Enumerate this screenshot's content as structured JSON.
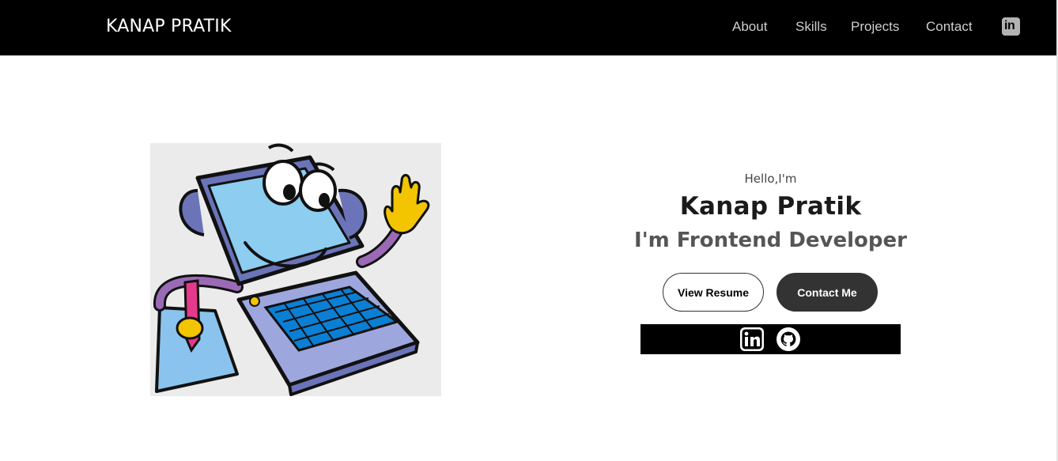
{
  "header": {
    "brand": "KANAP PRATIK",
    "nav": [
      {
        "label": "About"
      },
      {
        "label": "Skills"
      },
      {
        "label": "Projects"
      },
      {
        "label": "Contact"
      }
    ],
    "linkedin_icon": "linkedin-icon",
    "linkedin_glyph": "in"
  },
  "hero": {
    "greeting": "Hello,I'm",
    "name": "Kanap Pratik",
    "role": "I'm Frontend Developer",
    "buttons": {
      "resume": "View Resume",
      "contact": "Contact Me"
    },
    "socials": [
      "linkedin-icon",
      "github-icon"
    ],
    "illustration": "cartoon-laptop-character"
  },
  "colors": {
    "header_bg": "#000000",
    "nav_text": "#cfcfcf",
    "button_dark": "#333333",
    "role_text": "#555555"
  }
}
